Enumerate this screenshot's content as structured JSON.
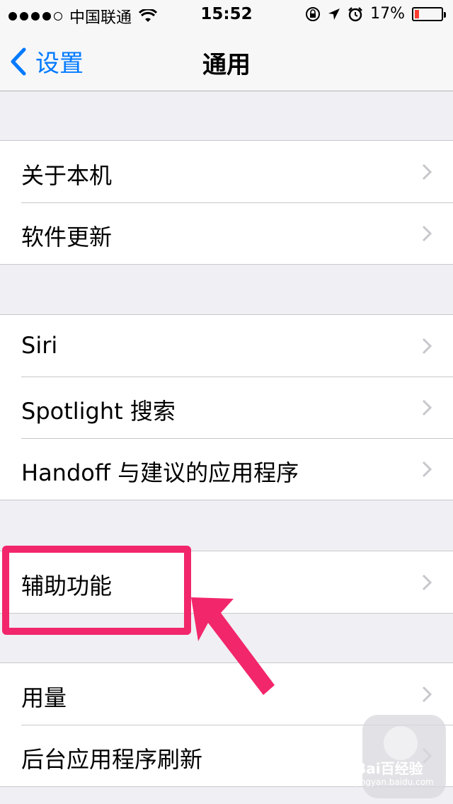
{
  "status_bar": {
    "carrier": "中国联通",
    "time": "15:52",
    "battery": "17%",
    "battery_level": 0.17,
    "signal_bars_filled": 4,
    "icons": [
      "wifi-icon",
      "rotation-lock-icon",
      "location-icon",
      "alarm-icon"
    ]
  },
  "nav": {
    "back_label": "设置",
    "title": "通用"
  },
  "groups": [
    {
      "items": [
        "关于本机",
        "软件更新"
      ]
    },
    {
      "items": [
        "Siri",
        "Spotlight 搜索",
        "Handoff 与建议的应用程序"
      ]
    },
    {
      "items": [
        "辅助功能"
      ]
    },
    {
      "items": [
        "用量",
        "后台应用程序刷新"
      ]
    }
  ],
  "watermark": {
    "brand": "Bai百经验",
    "url": "jingyan.baidu.com"
  },
  "colors": {
    "accent": "#007aff",
    "highlight": "#f2266b",
    "background": "#efeff4"
  }
}
